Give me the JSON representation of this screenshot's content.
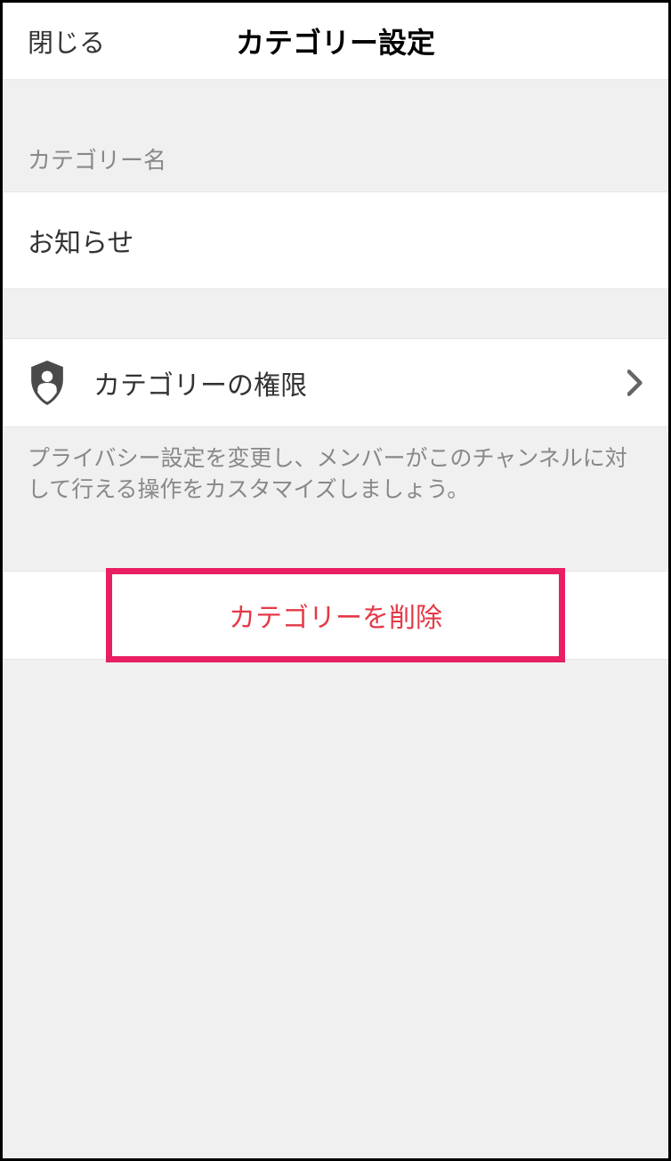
{
  "header": {
    "close_label": "閉じる",
    "title": "カテゴリー設定"
  },
  "category_name": {
    "section_label": "カテゴリー名",
    "value": "お知らせ"
  },
  "permissions": {
    "label": "カテゴリーの権限",
    "description": "プライバシー設定を変更し、メンバーがこのチャンネルに対して行える操作をカスタマイズしましょう。"
  },
  "delete": {
    "label": "カテゴリーを削除"
  }
}
